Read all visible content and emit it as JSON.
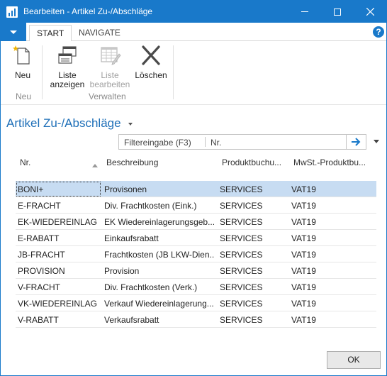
{
  "window": {
    "title": "Bearbeiten - Artikel Zu-/Abschläge"
  },
  "ribbon": {
    "tabs": [
      {
        "label": "START"
      },
      {
        "label": "NAVIGATE"
      }
    ],
    "help": "?",
    "buttons": {
      "neu": {
        "label": "Neu"
      },
      "liste_anzeigen": {
        "line1": "Liste",
        "line2": "anzeigen"
      },
      "liste_bearbeiten": {
        "line1": "Liste",
        "line2": "bearbeiten"
      },
      "loeschen": {
        "label": "Löschen"
      }
    },
    "groups": {
      "neu": "Neu",
      "verwalten": "Verwalten"
    }
  },
  "page": {
    "title": "Artikel Zu-/Abschläge"
  },
  "filter": {
    "label": "Filtereingabe (F3)",
    "field": "Nr."
  },
  "table": {
    "columns": [
      "Nr.",
      "Beschreibung",
      "Produktbuchu...",
      "MwSt.-Produktbu..."
    ],
    "rows": [
      {
        "nr": "BONI+",
        "beschreibung": "Provisonen",
        "produkt": "SERVICES",
        "mwst": "VAT19"
      },
      {
        "nr": "E-FRACHT",
        "beschreibung": "Div. Frachtkosten (Eink.)",
        "produkt": "SERVICES",
        "mwst": "VAT19"
      },
      {
        "nr": "EK-WIEDEREINLAG",
        "beschreibung": "EK Wiedereinlagerungsgeb...",
        "produkt": "SERVICES",
        "mwst": "VAT19"
      },
      {
        "nr": "E-RABATT",
        "beschreibung": "Einkaufsrabatt",
        "produkt": "SERVICES",
        "mwst": "VAT19"
      },
      {
        "nr": "JB-FRACHT",
        "beschreibung": "Frachtkosten (JB LKW-Dien...",
        "produkt": "SERVICES",
        "mwst": "VAT19"
      },
      {
        "nr": "PROVISION",
        "beschreibung": "Provision",
        "produkt": "SERVICES",
        "mwst": "VAT19"
      },
      {
        "nr": "V-FRACHT",
        "beschreibung": "Div. Frachtkosten (Verk.)",
        "produkt": "SERVICES",
        "mwst": "VAT19"
      },
      {
        "nr": "VK-WIEDEREINLAG",
        "beschreibung": "Verkauf Wiedereinlagerung...",
        "produkt": "SERVICES",
        "mwst": "VAT19"
      },
      {
        "nr": "V-RABATT",
        "beschreibung": "Verkaufsrabatt",
        "produkt": "SERVICES",
        "mwst": "VAT19"
      }
    ]
  },
  "footer": {
    "ok_label": "OK"
  },
  "colors": {
    "accent": "#1979ca",
    "selection": "#c7dcf2",
    "title": "#1e6fb8"
  }
}
